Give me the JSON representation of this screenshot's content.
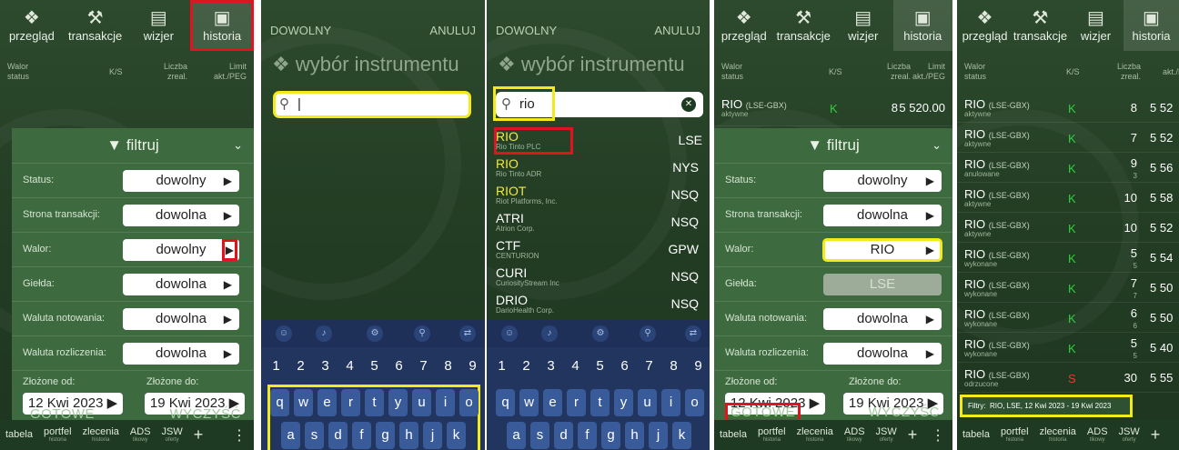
{
  "colors": {
    "bg": "#2d4a2e",
    "sheet": "#3d6a3f",
    "highlight_red": "#e0141e",
    "highlight_yellow": "#f3ea1a",
    "buy": "#2fcf3f",
    "sell": "#e83a2a",
    "keyboard": "#21355e"
  },
  "nav": {
    "przeglad": "przegląd",
    "transakcje": "transakcje",
    "wizjer": "wizjer",
    "historia": "historia"
  },
  "colhead": {
    "walor": "Walor",
    "status": "status",
    "ks": "K/S",
    "liczba": "Liczba",
    "zreal": "zreal.",
    "limit": "Limit",
    "akt_peg": "akt./PEG"
  },
  "filter": {
    "title": "filtruj",
    "status_label": "Status:",
    "status_value": "dowolny",
    "strona_label": "Strona transakcji:",
    "strona_value": "dowolna",
    "walor_label": "Walor:",
    "walor_value": "dowolny",
    "walor_value_set": "RIO",
    "gielda_label": "Giełda:",
    "gielda_value": "dowolna",
    "gielda_value_set": "LSE",
    "waluta_not_label": "Waluta notowania:",
    "waluta_not_value": "dowolna",
    "waluta_rozl_label": "Waluta rozliczenia:",
    "waluta_rozl_value": "dowolna",
    "od_label": "Złożone od:",
    "od_value": "12 Kwi 2023",
    "do_label": "Złożone do:",
    "do_value": "19 Kwi 2023",
    "gotowe": "GOTOWE",
    "wyczysc": "WYCZYŚĆ"
  },
  "bottomnav": {
    "tabela": "tabela",
    "portfel": "portfel",
    "portfel_sub": "historia",
    "zlecenia": "zlecenia",
    "zlecenia_sub": "historia",
    "ads": "ADS",
    "ads_sub": "tikowy",
    "jsw": "JSW",
    "jsw_sub": "oferty",
    "plus": "+",
    "dots": "⋮"
  },
  "picker": {
    "dowolny": "DOWOLNY",
    "anuluj": "ANULUJ",
    "title": "wybór instrumentu",
    "query_empty": "|",
    "query": "rio",
    "results": [
      {
        "sym": "RIO",
        "name": "Rio Tinto PLC",
        "ex": "LSE"
      },
      {
        "sym": "RIO",
        "name": "Rio Tinto ADR",
        "ex": "NYS"
      },
      {
        "sym": "RIOT",
        "name": "Riot Platforms, Inc.",
        "ex": "NSQ"
      },
      {
        "sym": "ATRI",
        "name": "Atrion Corp.",
        "ex": "NSQ"
      },
      {
        "sym": "CTF",
        "name": "CENTURION",
        "ex": "GPW"
      },
      {
        "sym": "CURI",
        "name": "CuriosityStream Inc",
        "ex": "NSQ"
      },
      {
        "sym": "DRIO",
        "name": "DarioHealth Corp.",
        "ex": "NSQ"
      }
    ]
  },
  "keyboard": {
    "numbers": [
      "1",
      "2",
      "3",
      "4",
      "5",
      "6",
      "7",
      "8",
      "9"
    ],
    "row1": [
      "q",
      "w",
      "e",
      "r",
      "t",
      "y",
      "u",
      "i",
      "o"
    ],
    "row2": [
      "a",
      "s",
      "d",
      "f",
      "g",
      "h",
      "j",
      "k"
    ]
  },
  "orders": {
    "first": {
      "sym": "RIO",
      "ex": "(LSE-GBX)",
      "status": "aktywne",
      "ks": "K",
      "qty": "8",
      "limit": "5 520.00"
    },
    "rows": [
      {
        "sym": "RIO",
        "ex": "(LSE-GBX)",
        "status": "aktywne",
        "ks": "K",
        "qty": "8",
        "qty2": "",
        "limit": "5 52"
      },
      {
        "sym": "RIO",
        "ex": "(LSE-GBX)",
        "status": "aktywne",
        "ks": "K",
        "qty": "7",
        "qty2": "",
        "limit": "5 52"
      },
      {
        "sym": "RIO",
        "ex": "(LSE-GBX)",
        "status": "anulowane",
        "ks": "K",
        "qty": "9",
        "qty2": "3",
        "limit": "5 56"
      },
      {
        "sym": "RIO",
        "ex": "(LSE-GBX)",
        "status": "aktywne",
        "ks": "K",
        "qty": "10",
        "qty2": "",
        "limit": "5 58"
      },
      {
        "sym": "RIO",
        "ex": "(LSE-GBX)",
        "status": "aktywne",
        "ks": "K",
        "qty": "10",
        "qty2": "",
        "limit": "5 52"
      },
      {
        "sym": "RIO",
        "ex": "(LSE-GBX)",
        "status": "wykonane",
        "ks": "K",
        "qty": "5",
        "qty2": "5",
        "limit": "5 54"
      },
      {
        "sym": "RIO",
        "ex": "(LSE-GBX)",
        "status": "wykonane",
        "ks": "K",
        "qty": "7",
        "qty2": "7",
        "limit": "5 50"
      },
      {
        "sym": "RIO",
        "ex": "(LSE-GBX)",
        "status": "wykonane",
        "ks": "K",
        "qty": "6",
        "qty2": "6",
        "limit": "5 50"
      },
      {
        "sym": "RIO",
        "ex": "(LSE-GBX)",
        "status": "wykonane",
        "ks": "K",
        "qty": "5",
        "qty2": "5",
        "limit": "5 40"
      },
      {
        "sym": "RIO",
        "ex": "(LSE-GBX)",
        "status": "odrzucone",
        "ks": "S",
        "qty": "30",
        "qty2": "",
        "limit": "5 55"
      }
    ],
    "filter_summary_label": "Filtry:",
    "filter_summary": "RIO, LSE, 12 Kwi 2023 - 19 Kwi 2023"
  }
}
